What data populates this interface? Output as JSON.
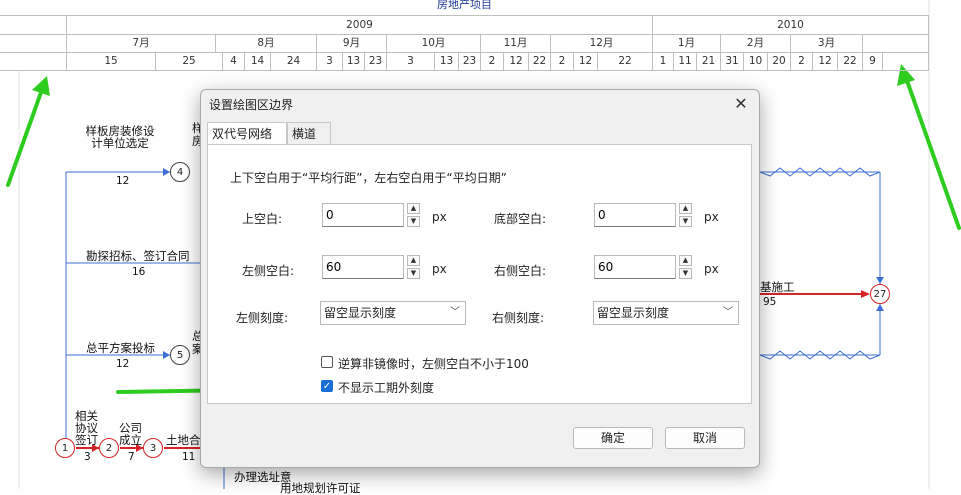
{
  "app": {
    "project_title": "房地产项目"
  },
  "timeline": {
    "years": [
      "2009",
      "2010"
    ],
    "months": [
      "7月",
      "8月",
      "9月",
      "10月",
      "11月",
      "12月",
      "1月",
      "2月",
      "3月"
    ],
    "days": [
      "15",
      "25",
      "4",
      "14",
      "24",
      "3",
      "13",
      "23",
      "3",
      "13",
      "23",
      "2",
      "12",
      "22",
      "2",
      "12",
      "22",
      "1",
      "11",
      "21",
      "31",
      "10",
      "20",
      "2",
      "12",
      "22",
      "9"
    ]
  },
  "network": {
    "activities": [
      {
        "name": "样板房装修设计单位选定",
        "duration": "12"
      },
      {
        "name": "勘探招标、签订合同",
        "duration": "16"
      },
      {
        "name": "总平方案投标",
        "duration": "12"
      },
      {
        "name": "相关协议签订",
        "duration": "3"
      },
      {
        "name": "公司成立",
        "duration": "7"
      },
      {
        "name": "土地合",
        "duration": "11"
      },
      {
        "name": "基施工",
        "duration": "95"
      },
      {
        "name": "办理选址意",
        "duration": ""
      },
      {
        "name": "用地规划许可证",
        "duration": ""
      }
    ],
    "nodes": [
      "1",
      "2",
      "3",
      "4",
      "5",
      "27"
    ],
    "partial_labels": [
      "样",
      "房",
      "总",
      "案"
    ]
  },
  "dialog": {
    "title": "设置绘图区边界",
    "close_glyph": "✕",
    "tabs": [
      "双代号网络图",
      "横道图"
    ],
    "active_tab": 0,
    "hint": "上下空白用于“平均行距”，左右空白用于“平均日期”",
    "fields": {
      "top_label": "上空白:",
      "top_value": "0",
      "bottom_label": "底部空白:",
      "bottom_value": "0",
      "left_label": "左侧空白:",
      "left_value": "60",
      "right_label": "右侧空白:",
      "right_value": "60",
      "unit": "px"
    },
    "scales": {
      "left_label": "左侧刻度:",
      "left_value": "留空显示刻度",
      "right_label": "右侧刻度:",
      "right_value": "留空显示刻度"
    },
    "checkboxes": [
      {
        "label": "逆算非镜像时，左侧空白不小于100",
        "checked": false
      },
      {
        "label": "不显示工期外刻度",
        "checked": true
      }
    ],
    "ok_label": "确定",
    "cancel_label": "取消"
  },
  "colors": {
    "arrow_green": "#2ecc1f",
    "link_blue": "#3b6fd4",
    "critical_red": "#d42424",
    "accent": "#1a6fd6"
  }
}
